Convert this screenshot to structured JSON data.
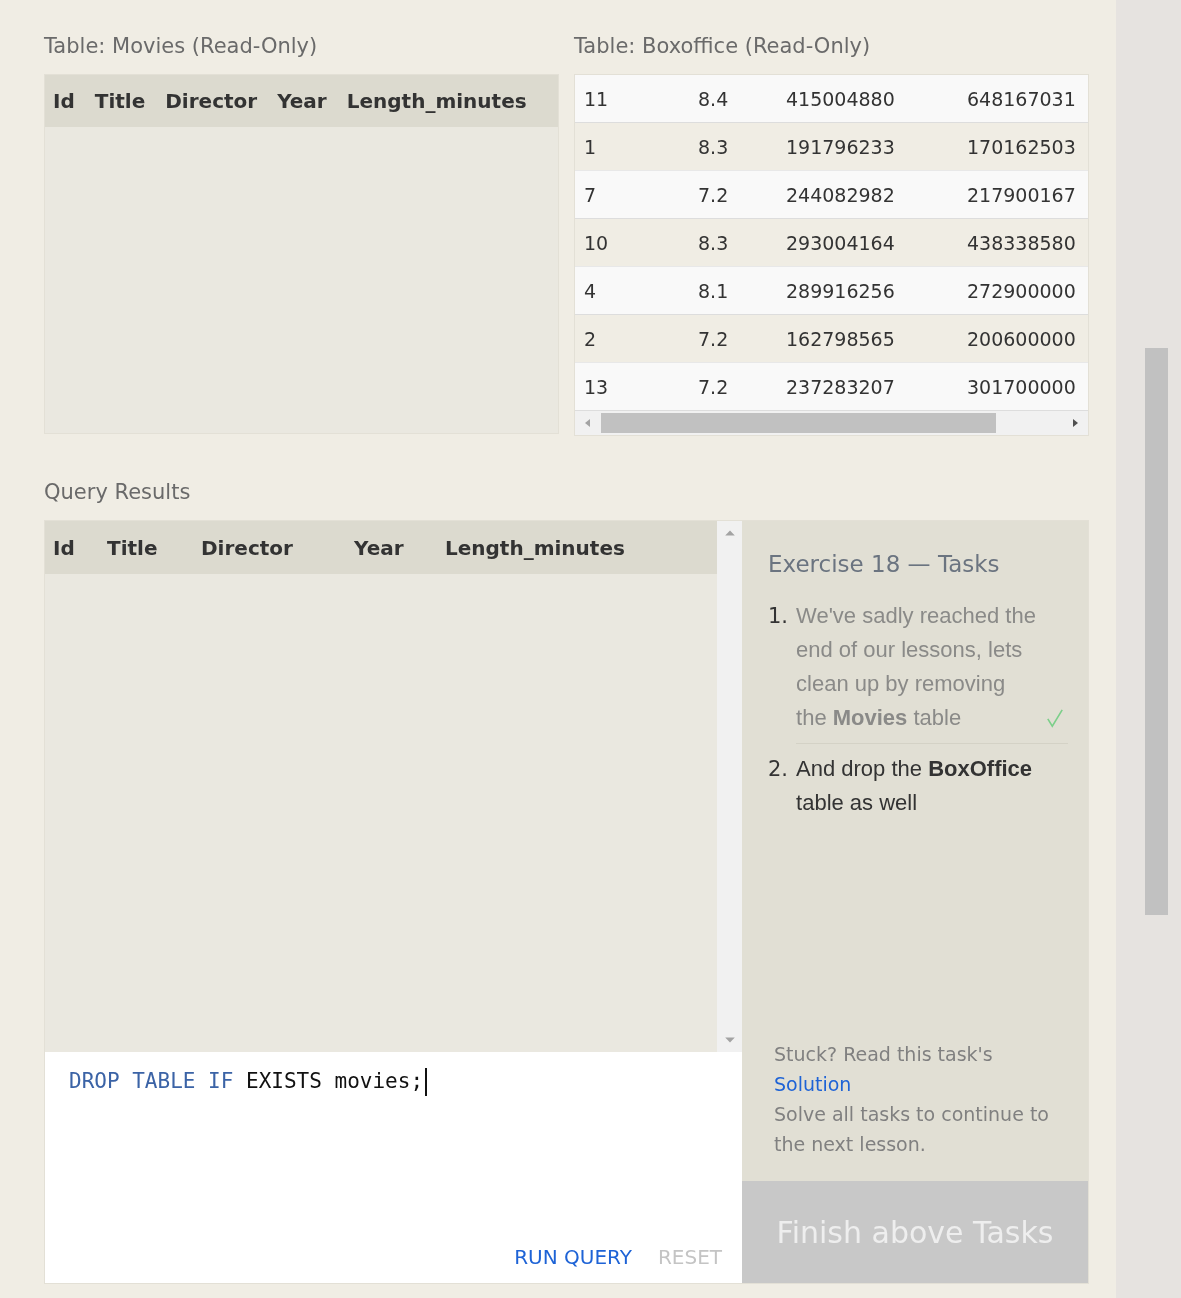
{
  "movies_table": {
    "title": "Table: Movies (Read-Only)",
    "columns": [
      "Id",
      "Title",
      "Director",
      "Year",
      "Length_minutes"
    ]
  },
  "boxoffice_table": {
    "title": "Table: Boxoffice (Read-Only)",
    "rows": [
      [
        "11",
        "8.4",
        "415004880",
        "648167031"
      ],
      [
        "1",
        "8.3",
        "191796233",
        "170162503"
      ],
      [
        "7",
        "7.2",
        "244082982",
        "217900167"
      ],
      [
        "10",
        "8.3",
        "293004164",
        "438338580"
      ],
      [
        "4",
        "8.1",
        "289916256",
        "272900000"
      ],
      [
        "2",
        "7.2",
        "162798565",
        "200600000"
      ],
      [
        "13",
        "7.2",
        "237283207",
        "301700000"
      ]
    ]
  },
  "query_results": {
    "title": "Query Results",
    "columns": [
      "Id",
      "Title",
      "Director",
      "Year",
      "Length_minutes"
    ]
  },
  "editor": {
    "tokens": [
      {
        "kind": "keyword",
        "text": "DROP TABLE IF"
      },
      {
        "kind": "plain",
        "text": "EXISTS movies;"
      }
    ],
    "buttons": [
      {
        "label": "RUN QUERY",
        "disabled": false
      },
      {
        "label": "RESET",
        "disabled": true
      }
    ]
  },
  "tasks": {
    "title": "Exercise 18 — Tasks",
    "items": [
      {
        "number": "1.",
        "text": "We've sadly reached the end of our lessons, lets clean up by removing the **Movies** table",
        "done": true
      },
      {
        "number": "2.",
        "text": "And drop the **BoxOffice** table as well",
        "done": false
      }
    ],
    "help_prefix": "Stuck? Read this task's",
    "solution_link": "Solution",
    "help_suffix": "Solve all tasks to continue to the next lesson.",
    "finish_button": {
      "label": "Finish above Tasks",
      "disabled": true
    }
  }
}
